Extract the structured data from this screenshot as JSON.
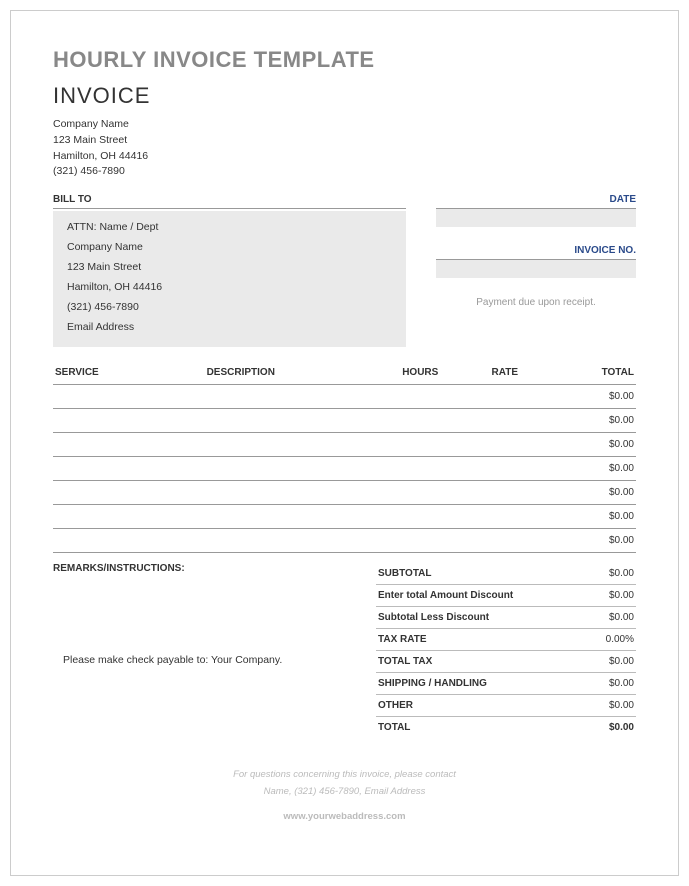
{
  "title": "HOURLY INVOICE TEMPLATE",
  "subtitle": "INVOICE",
  "from": {
    "company": "Company Name",
    "street": "123 Main Street",
    "city": "Hamilton, OH 44416",
    "phone": "(321) 456-7890"
  },
  "labels": {
    "bill_to": "BILL TO",
    "date": "DATE",
    "invoice_no": "INVOICE NO.",
    "payment_note": "Payment due upon receipt.",
    "service": "SERVICE",
    "description": "DESCRIPTION",
    "hours": "HOURS",
    "rate": "RATE",
    "total": "TOTAL",
    "remarks": "REMARKS/INSTRUCTIONS:",
    "payable": "Please make check payable to: Your Company."
  },
  "bill_to": {
    "attn": "ATTN: Name / Dept",
    "company": "Company Name",
    "street": "123 Main Street",
    "city": "Hamilton, OH  44416",
    "phone": "(321) 456-7890",
    "email": "Email Address"
  },
  "fields": {
    "date": "",
    "invoice_no": ""
  },
  "line_items": [
    {
      "service": "",
      "description": "",
      "hours": "",
      "rate": "",
      "total": "$0.00"
    },
    {
      "service": "",
      "description": "",
      "hours": "",
      "rate": "",
      "total": "$0.00"
    },
    {
      "service": "",
      "description": "",
      "hours": "",
      "rate": "",
      "total": "$0.00"
    },
    {
      "service": "",
      "description": "",
      "hours": "",
      "rate": "",
      "total": "$0.00"
    },
    {
      "service": "",
      "description": "",
      "hours": "",
      "rate": "",
      "total": "$0.00"
    },
    {
      "service": "",
      "description": "",
      "hours": "",
      "rate": "",
      "total": "$0.00"
    },
    {
      "service": "",
      "description": "",
      "hours": "",
      "rate": "",
      "total": "$0.00"
    }
  ],
  "summary": {
    "subtotal": {
      "label": "SUBTOTAL",
      "value": "$0.00"
    },
    "discount": {
      "label": "Enter total Amount Discount",
      "value": "$0.00"
    },
    "less_discount": {
      "label": "Subtotal Less Discount",
      "value": "$0.00"
    },
    "tax_rate": {
      "label": "TAX RATE",
      "value": "0.00%"
    },
    "total_tax": {
      "label": "TOTAL TAX",
      "value": "$0.00"
    },
    "shipping": {
      "label": "SHIPPING / HANDLING",
      "value": "$0.00"
    },
    "other": {
      "label": "OTHER",
      "value": "$0.00"
    },
    "total": {
      "label": "TOTAL",
      "value": "$0.00"
    }
  },
  "footer": {
    "line1": "For questions concerning this invoice, please contact",
    "line2": "Name, (321) 456-7890, Email Address",
    "web": "www.yourwebaddress.com"
  }
}
